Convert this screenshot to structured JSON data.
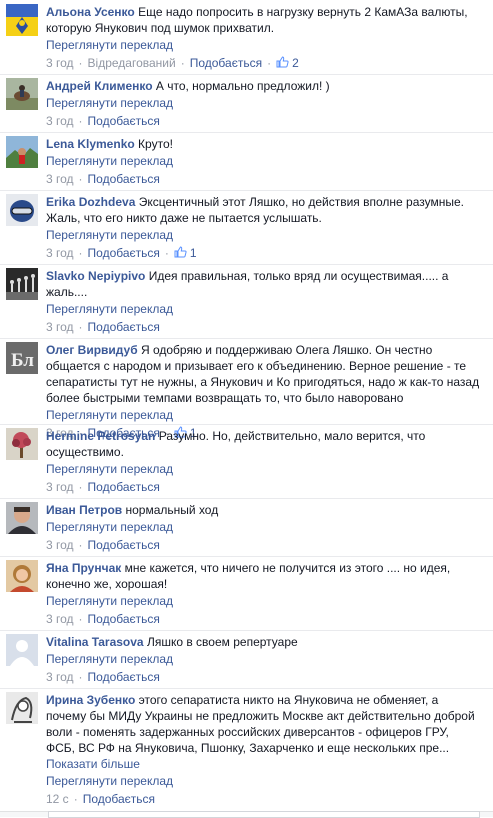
{
  "ui": {
    "translate_label": "Переглянути переклад",
    "like_label": "Подобається",
    "show_more_label": "Показати більше",
    "edited_label": "Відредагований",
    "separator": "·"
  },
  "comments": [
    {
      "author": "Альона Усенко",
      "text": "Еще надо попросить в нагрузку вернуть 2 КамАЗа валюты, которую Янукович под шумок прихватил.",
      "time": "3 год",
      "edited": true,
      "likes": "2",
      "avatar": "flag-avatar"
    },
    {
      "author": "Андрей Клименко",
      "text": "А что, нормально предложил! )",
      "time": "3 год",
      "avatar": "horse-avatar"
    },
    {
      "author": "Lena Klymenko",
      "text": "Круто!",
      "time": "3 год",
      "avatar": "landscape-avatar"
    },
    {
      "author": "Erika Dozhdeva",
      "text": "Эксцентичный этот Ляшко, но действия вполне разумные. Жаль, что его никто даже не пытается услышать.",
      "time": "3 год",
      "likes": "1",
      "avatar": "helmet-avatar"
    },
    {
      "author": "Slavko Nepiypivo",
      "text": "Идея правильная, только вряд ли осуществимая..... а жаль....",
      "time": "3 год",
      "avatar": "evolution-avatar"
    },
    {
      "author": "Олег Вирвидуб",
      "text": "Я одобряю и поддерживаю Олега Ляшко. Он честно общается с народом и призывает его к объединению. Верное решение - те сепаратисты тут не нужны, а Янукович и Ко пригодяться, надо ж как-то назад более быстрыми темпами возвращать то, что было наворовано",
      "time": "3 год",
      "likes": "1",
      "avatar": "logo-avatar"
    },
    {
      "author": "Hermine Petrosyan",
      "text": "Разумно. Но, действительно, мало верится, что осуществимо.",
      "time": "3 год",
      "avatar": "tree-avatar"
    },
    {
      "author": "Иван Петров",
      "text": "нормальный ход",
      "time": "3 год",
      "avatar": "man-avatar"
    },
    {
      "author": "Яна Прунчак",
      "text": "мне кажется, что ничего не получится из этого .... но идея, конечно же, хорошая!",
      "time": "3 год",
      "avatar": "woman-avatar"
    },
    {
      "author": "Vitalina Tarasova",
      "text": "Ляшко в своем репертуаре",
      "time": "3 год",
      "avatar": "default-avatar"
    },
    {
      "author": "Ирина Зубенко",
      "text": "этого сепаратиста никто на Януковича не обменяет, а почему бы МИДу Украины не предложить Москве акт действительно доброй воли - поменять задержанных российских диверсантов - офицеров ГРУ, ФСБ, ВС РФ на Януковича, Пшонку, Захарченко и еще нескольких пре...",
      "time": "12 с",
      "show_more": true,
      "avatar": "sketch-avatar"
    }
  ],
  "colors": {
    "link": "#3b5998",
    "meta": "#9197a3",
    "text": "#141823"
  }
}
